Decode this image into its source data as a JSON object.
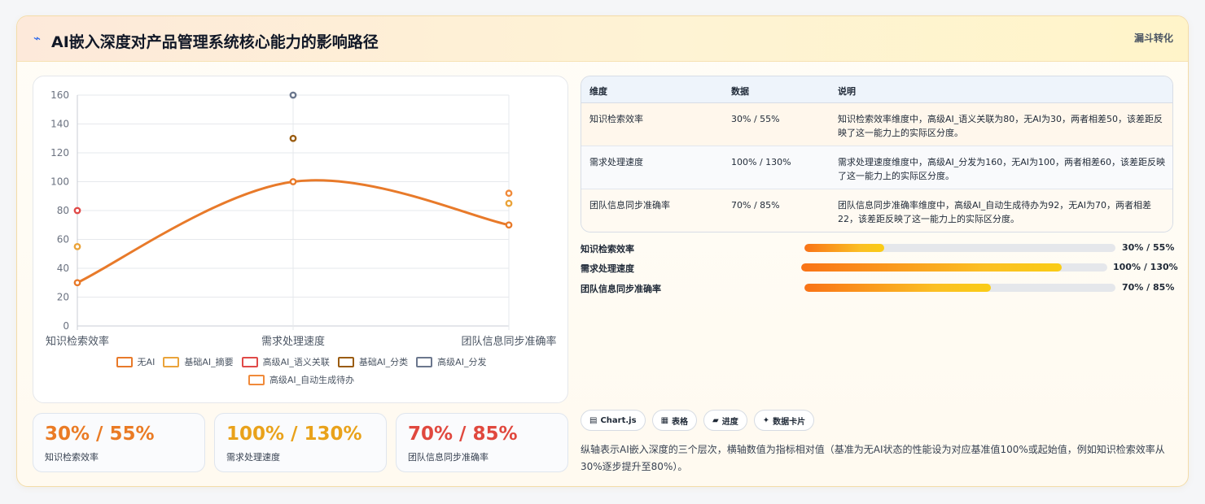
{
  "header": {
    "icon": "lightning-icon",
    "title": "AI嵌入深度对产品管理系统核心能力的影响路径",
    "badge": "漏斗转化"
  },
  "chart_data": {
    "type": "line",
    "categories": [
      "知识检索效率",
      "需求处理速度",
      "团队信息同步准确率"
    ],
    "ylim": [
      0,
      160
    ],
    "yticks": [
      0,
      20,
      40,
      60,
      80,
      100,
      120,
      140,
      160
    ],
    "grid": true,
    "legend_position": "bottom",
    "series": [
      {
        "name": "无AI",
        "color": "#e87a2a",
        "values": [
          30,
          100,
          70
        ],
        "show_line": true
      },
      {
        "name": "基础AI_摘要",
        "color": "#eaa33a",
        "values": [
          55,
          null,
          85
        ],
        "show_line": false
      },
      {
        "name": "高级AI_语义关联",
        "color": "#e04a48",
        "values": [
          80,
          null,
          null
        ],
        "show_line": false
      },
      {
        "name": "基础AI_分类",
        "color": "#9a5c10",
        "values": [
          null,
          130,
          null
        ],
        "show_line": false
      },
      {
        "name": "高级AI_分发",
        "color": "#6b778d",
        "values": [
          null,
          160,
          null
        ],
        "show_line": false
      },
      {
        "name": "高级AI_自动生成待办",
        "color": "#f08a3a",
        "values": [
          null,
          null,
          92
        ],
        "show_line": false
      }
    ]
  },
  "kpis": [
    {
      "value": "30% / 55%",
      "label": "知识检索效率",
      "color": "#ea7b25"
    },
    {
      "value": "100% / 130%",
      "label": "需求处理速度",
      "color": "#e9a21b"
    },
    {
      "value": "70% / 85%",
      "label": "团队信息同步准确率",
      "color": "#e0483e"
    }
  ],
  "table": {
    "headers": [
      "维度",
      "数据",
      "说明"
    ],
    "rows": [
      {
        "dim": "知识检索效率",
        "data": "30% / 55%",
        "desc": "知识检索效率维度中，高级AI_语义关联为80，无AI为30，两者相差50，该差距反映了这一能力上的实际区分度。"
      },
      {
        "dim": "需求处理速度",
        "data": "100% / 130%",
        "desc": "需求处理速度维度中，高级AI_分发为160，无AI为100，两者相差60，该差距反映了这一能力上的实际区分度。"
      },
      {
        "dim": "团队信息同步准确率",
        "data": "70% / 85%",
        "desc": "团队信息同步准确率维度中，高级AI_自动生成待办为92，无AI为70，两者相差22，该差距反映了这一能力上的实际区分度。"
      }
    ]
  },
  "progress": [
    {
      "label": "知识检索效率",
      "value": "30% / 55%",
      "fill": 0.257
    },
    {
      "label": "需求处理速度",
      "value": "100% / 130%",
      "fill": 0.85
    },
    {
      "label": "团队信息同步准确率",
      "value": "70% / 85%",
      "fill": 0.6
    }
  ],
  "chips": [
    {
      "icon": "chart-icon",
      "glyph": "▤",
      "label": "Chart.js"
    },
    {
      "icon": "table-icon",
      "glyph": "▦",
      "label": "表格"
    },
    {
      "icon": "progress-icon",
      "glyph": "▰",
      "label": "进度"
    },
    {
      "icon": "sparkle-icon",
      "glyph": "✦",
      "label": "数据卡片"
    }
  ],
  "note": "纵轴表示AI嵌入深度的三个层次，横轴数值为指标相对值（基准为无AI状态的性能设为对应基准值100%或起始值，例如知识检索效率从30%逐步提升至80%）。"
}
